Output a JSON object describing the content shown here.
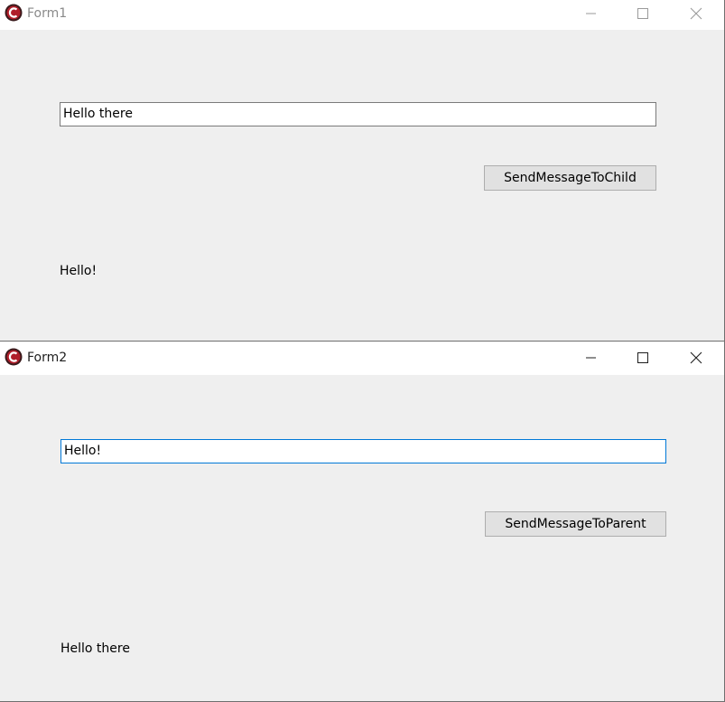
{
  "form1": {
    "title": "Form1",
    "icon": "app-icon",
    "textbox_value": "Hello there",
    "button_label": "SendMessageToChild",
    "received_label": "Hello!"
  },
  "form2": {
    "title": "Form2",
    "icon": "app-icon",
    "textbox_value": "Hello!",
    "button_label": "SendMessageToParent",
    "received_label": "Hello there"
  },
  "colors": {
    "window_bg": "#efefef",
    "titlebar_bg": "#ffffff",
    "inactive_title": "#8a8a8a",
    "active_title": "#1e1e1e",
    "focus_border": "#0078d7",
    "button_bg": "#e1e1e1",
    "icon_red": "#b01e2a"
  }
}
